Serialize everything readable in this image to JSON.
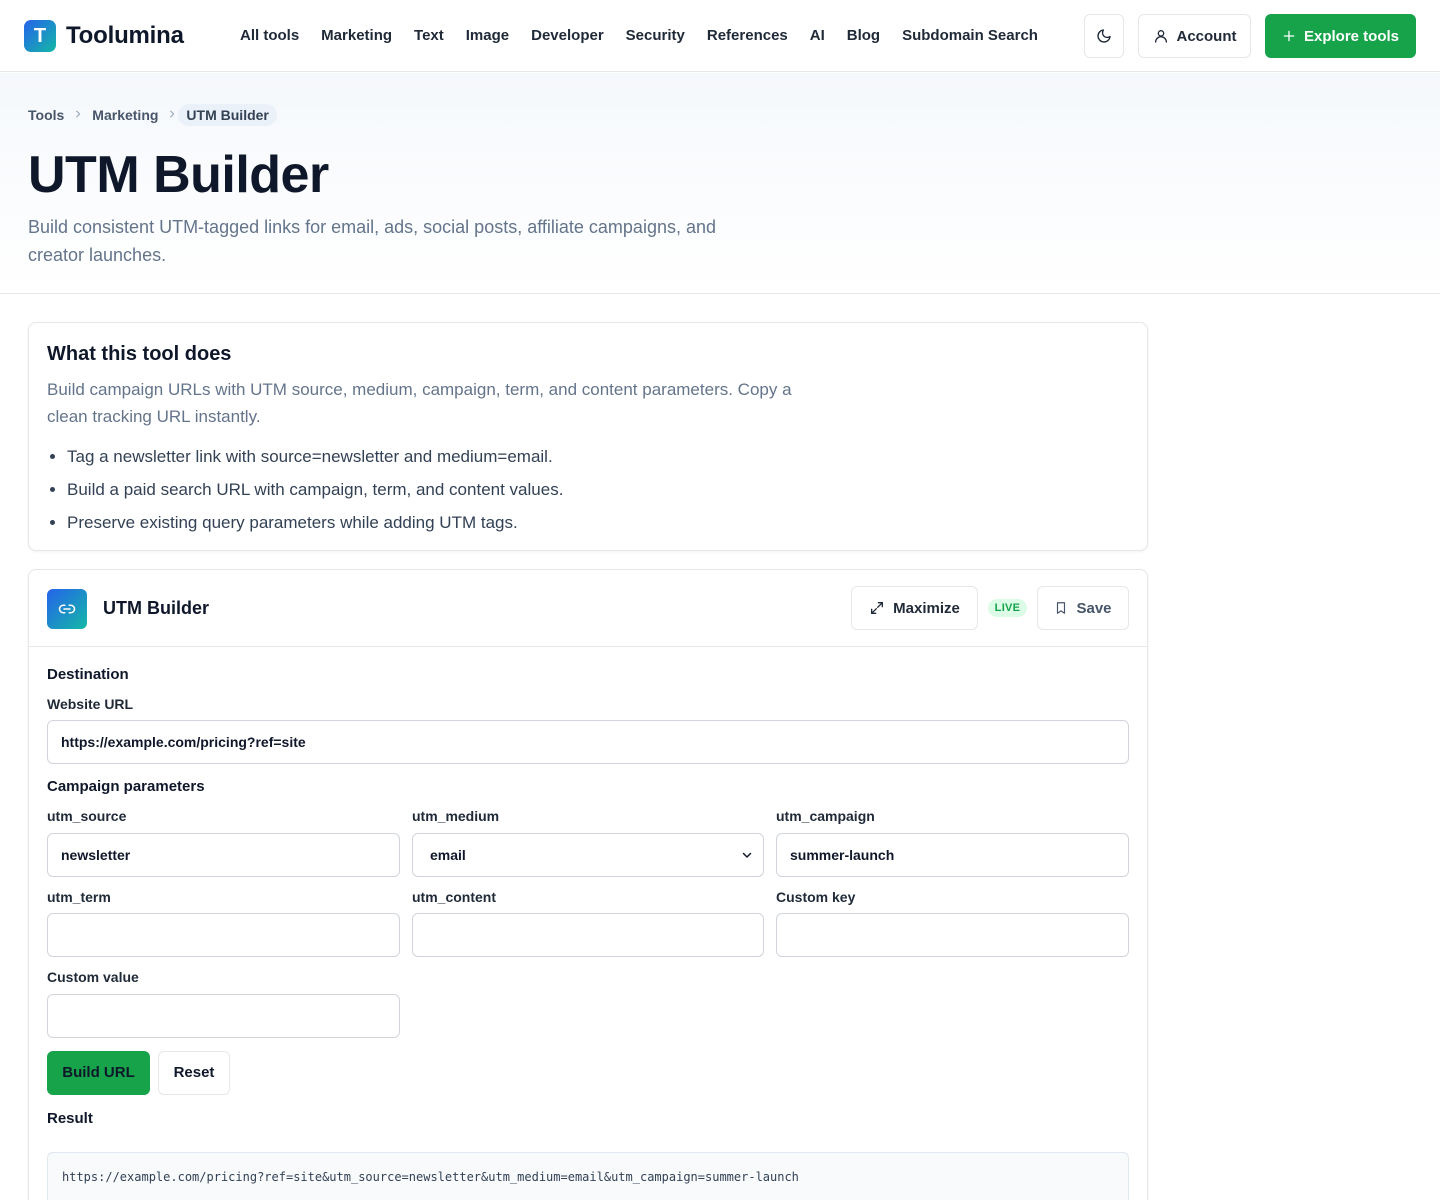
{
  "header": {
    "logo_letter": "T",
    "brand": "Toolumina",
    "nav": [
      "All tools",
      "Marketing",
      "Text",
      "Image",
      "Developer",
      "Security",
      "References",
      "AI",
      "Blog",
      "Subdomain Search"
    ],
    "account_label": "Account",
    "explore_label": "Explore tools"
  },
  "breadcrumbs": [
    "Tools",
    "Marketing",
    "UTM Builder"
  ],
  "hero": {
    "title": "UTM Builder",
    "subtitle": "Build consistent UTM-tagged links for email, ads, social posts, affiliate campaigns, and creator launches."
  },
  "about": {
    "heading": "What this tool does",
    "description": "Build campaign URLs with UTM source, medium, campaign, term, and content parameters. Copy a clean tracking URL instantly.",
    "bullets": [
      "Tag a newsletter link with source=newsletter and medium=email.",
      "Build a paid search URL with campaign, term, and content values.",
      "Preserve existing query parameters while adding UTM tags."
    ]
  },
  "tool": {
    "name": "UTM Builder",
    "maximize_label": "Maximize",
    "live_badge": "LIVE",
    "save_label": "Save",
    "destination_heading": "Destination",
    "website_url_label": "Website URL",
    "website_url_value": "https://example.com/pricing?ref=site",
    "params_heading": "Campaign parameters",
    "fields": {
      "utm_source": {
        "label": "utm_source",
        "value": "newsletter"
      },
      "utm_medium": {
        "label": "utm_medium",
        "value": "email"
      },
      "utm_campaign": {
        "label": "utm_campaign",
        "value": "summer-launch"
      },
      "utm_term": {
        "label": "utm_term",
        "value": ""
      },
      "utm_content": {
        "label": "utm_content",
        "value": ""
      },
      "custom_key": {
        "label": "Custom key",
        "value": ""
      },
      "custom_value": {
        "label": "Custom value",
        "value": ""
      }
    },
    "build_label": "Build URL",
    "reset_label": "Reset",
    "result_heading": "Result",
    "result_value": "https://example.com/pricing?ref=site&utm_source=newsletter&utm_medium=email&utm_campaign=summer-launch"
  },
  "colors": {
    "accent": "#16a34a",
    "brand_gradient_start": "#2563eb",
    "brand_gradient_end": "#14b8a6"
  },
  "icons": [
    "moon-icon",
    "user-icon",
    "plus-icon",
    "link-icon",
    "expand-icon",
    "bookmark-icon",
    "chevron-down-icon",
    "chevron-right-icon"
  ]
}
